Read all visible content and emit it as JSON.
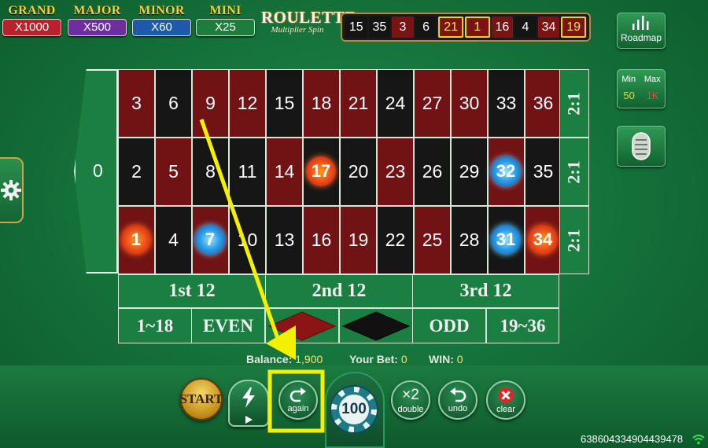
{
  "jackpots": [
    {
      "label": "GRAND",
      "value": "X1000",
      "color": "#b8232b"
    },
    {
      "label": "MAJOR",
      "value": "X500",
      "color": "#6d2f9e"
    },
    {
      "label": "MINOR",
      "value": "X60",
      "color": "#1d5aa8"
    },
    {
      "label": "MINI",
      "value": "X25",
      "color": "#1e7d3a"
    }
  ],
  "logo": {
    "title": "ROULETTE",
    "subtitle": "Multiplier Spin"
  },
  "history": [
    {
      "n": "15",
      "c": "black",
      "hl": false
    },
    {
      "n": "35",
      "c": "black",
      "hl": false
    },
    {
      "n": "3",
      "c": "red",
      "hl": false
    },
    {
      "n": "6",
      "c": "black",
      "hl": false
    },
    {
      "n": "21",
      "c": "red",
      "hl": true
    },
    {
      "n": "1",
      "c": "red",
      "hl": true
    },
    {
      "n": "16",
      "c": "red",
      "hl": false
    },
    {
      "n": "4",
      "c": "black",
      "hl": false
    },
    {
      "n": "34",
      "c": "red",
      "hl": false
    },
    {
      "n": "19",
      "c": "red",
      "hl": true
    }
  ],
  "roadmap_label": "Roadmap",
  "limits": {
    "min_label": "Min",
    "max_label": "Max",
    "min": "50",
    "max": "1K"
  },
  "zero": "0",
  "rows": [
    [
      "3",
      "6",
      "9",
      "12",
      "15",
      "18",
      "21",
      "24",
      "27",
      "30",
      "33",
      "36"
    ],
    [
      "2",
      "5",
      "8",
      "11",
      "14",
      "17",
      "20",
      "23",
      "26",
      "29",
      "32",
      "35"
    ],
    [
      "1",
      "4",
      "7",
      "10",
      "13",
      "16",
      "19",
      "22",
      "25",
      "28",
      "31",
      "34"
    ]
  ],
  "red_numbers": [
    "1",
    "3",
    "5",
    "7",
    "9",
    "12",
    "14",
    "16",
    "18",
    "19",
    "21",
    "23",
    "25",
    "27",
    "30",
    "32",
    "34",
    "36"
  ],
  "column_bets": [
    "2:1",
    "2:1",
    "2:1"
  ],
  "dozens": [
    "1st  12",
    "2nd  12",
    "3rd  12"
  ],
  "outside": {
    "low": "1~18",
    "even": "EVEN",
    "odd": "ODD",
    "high": "19~36"
  },
  "multipliers": [
    {
      "n": "17",
      "type": "fire"
    },
    {
      "n": "1",
      "type": "fire"
    },
    {
      "n": "34",
      "type": "fire"
    },
    {
      "n": "32",
      "type": "ice"
    },
    {
      "n": "7",
      "type": "ice"
    },
    {
      "n": "31",
      "type": "ice"
    }
  ],
  "status": {
    "balance_label": "Balance:",
    "balance": "1,900",
    "bet_label": "Your Bet:",
    "bet": "0",
    "win_label": "WIN:",
    "win": "0"
  },
  "controls": {
    "start": "START",
    "again": "again",
    "chip": "100",
    "double_icon": "×2",
    "double": "double",
    "undo": "undo",
    "clear": "clear"
  },
  "session_id": "638604334904439478",
  "annotation_color": "#f4f000"
}
